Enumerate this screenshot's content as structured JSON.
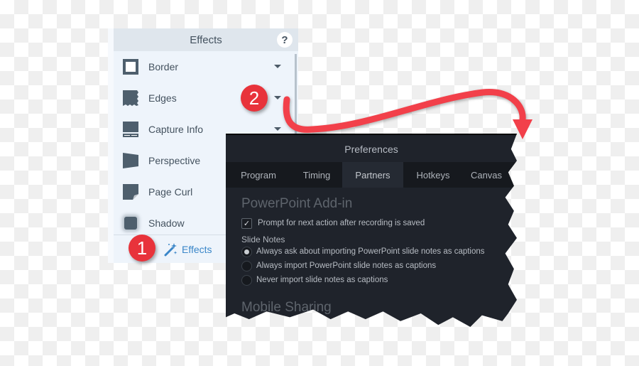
{
  "effects_panel": {
    "title": "Effects",
    "help_label": "?",
    "items": [
      {
        "label": "Border",
        "icon": "border-icon",
        "has_menu": true
      },
      {
        "label": "Edges",
        "icon": "edges-icon",
        "has_menu": true
      },
      {
        "label": "Capture Info",
        "icon": "capture-info-icon",
        "has_menu": true
      },
      {
        "label": "Perspective",
        "icon": "perspective-icon",
        "has_menu": false
      },
      {
        "label": "Page Curl",
        "icon": "page-curl-icon",
        "has_menu": false
      },
      {
        "label": "Shadow",
        "icon": "shadow-icon",
        "has_menu": false
      }
    ],
    "footer_label": "Effects",
    "footer_icon": "magic-wand-icon"
  },
  "annotations": {
    "badge_1": "1",
    "badge_2": "2",
    "badge_color": "#e8333b",
    "arrow_color": "#f2404a"
  },
  "preferences": {
    "title": "Preferences",
    "tabs": [
      {
        "label": "Program",
        "active": false
      },
      {
        "label": "Timing",
        "active": false
      },
      {
        "label": "Partners",
        "active": true
      },
      {
        "label": "Hotkeys",
        "active": false
      },
      {
        "label": "Canvas",
        "active": false
      }
    ],
    "powerpoint_section": {
      "title": "PowerPoint Add-in",
      "prompt_checkbox": {
        "label": "Prompt for next action after recording is saved",
        "checked": true,
        "check_glyph": "✓"
      },
      "slide_notes_label": "Slide Notes",
      "options": [
        {
          "label": "Always ask about importing PowerPoint slide notes as captions",
          "selected": true
        },
        {
          "label": "Always import PowerPoint slide notes as captions",
          "selected": false
        },
        {
          "label": "Never import slide notes as captions",
          "selected": false
        }
      ]
    },
    "mobile_section": {
      "title": "Mobile Sharing"
    }
  }
}
